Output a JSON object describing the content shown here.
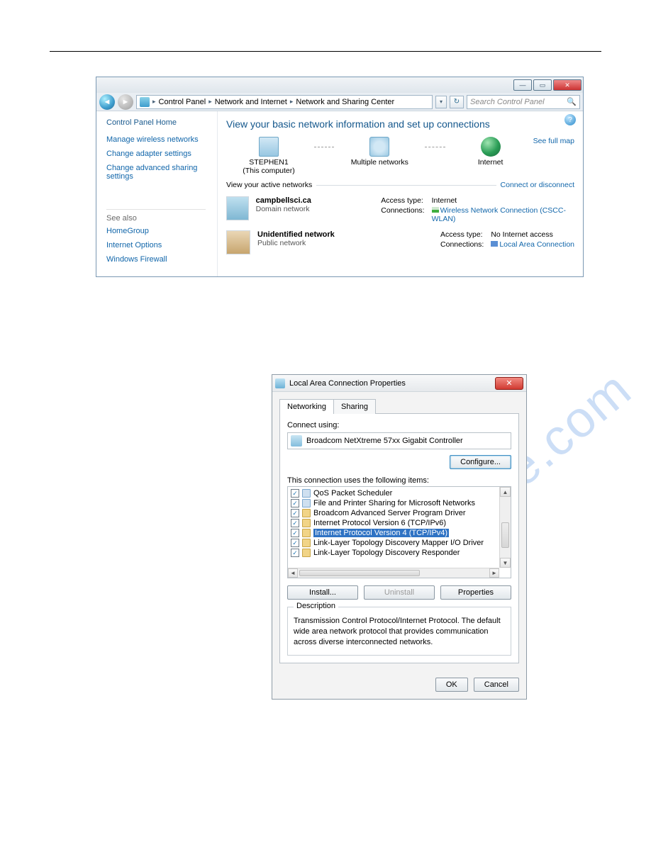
{
  "watermark": "manualslive.com",
  "win1": {
    "breadcrumb": [
      "Control Panel",
      "Network and Internet",
      "Network and Sharing Center"
    ],
    "search_placeholder": "Search Control Panel",
    "sidebar": {
      "home": "Control Panel Home",
      "links": [
        "Manage wireless networks",
        "Change adapter settings",
        "Change advanced sharing settings"
      ],
      "seealso_hdr": "See also",
      "seealso": [
        "HomeGroup",
        "Internet Options",
        "Windows Firewall"
      ]
    },
    "main": {
      "heading": "View your basic network information and set up connections",
      "see_full_map": "See full map",
      "map": {
        "pc_name": "STEPHEN1",
        "pc_sub": "(This computer)",
        "mid": "Multiple networks",
        "right": "Internet"
      },
      "active_hdr": "View your active networks",
      "conn_disc": "Connect or disconnect",
      "nets": [
        {
          "title": "campbellsci.ca",
          "sub": "Domain network",
          "access_label": "Access type:",
          "access_value": "Internet",
          "conn_label": "Connections:",
          "conn_link": "Wireless Network Connection (CSCC-WLAN)"
        },
        {
          "title": "Unidentified network",
          "sub": "Public network",
          "access_label": "Access type:",
          "access_value": "No Internet access",
          "conn_label": "Connections:",
          "conn_link": "Local Area Connection"
        }
      ]
    }
  },
  "win2": {
    "title": "Local Area Connection Properties",
    "tabs": {
      "networking": "Networking",
      "sharing": "Sharing"
    },
    "connect_using_label": "Connect using:",
    "adapter": "Broadcom NetXtreme 57xx Gigabit Controller",
    "configure": "Configure...",
    "items_label": "This connection uses the following items:",
    "items": [
      {
        "text": "QoS Packet Scheduler",
        "svc": true
      },
      {
        "text": "File and Printer Sharing for Microsoft Networks",
        "svc": true
      },
      {
        "text": "Broadcom Advanced Server Program Driver"
      },
      {
        "text": "Internet Protocol Version 6 (TCP/IPv6)"
      },
      {
        "text": "Internet Protocol Version 4 (TCP/IPv4)",
        "selected": true
      },
      {
        "text": "Link-Layer Topology Discovery Mapper I/O Driver"
      },
      {
        "text": "Link-Layer Topology Discovery Responder"
      }
    ],
    "install": "Install...",
    "uninstall": "Uninstall",
    "properties": "Properties",
    "desc_label": "Description",
    "desc": "Transmission Control Protocol/Internet Protocol. The default wide area network protocol that provides communication across diverse interconnected networks.",
    "ok": "OK",
    "cancel": "Cancel"
  }
}
